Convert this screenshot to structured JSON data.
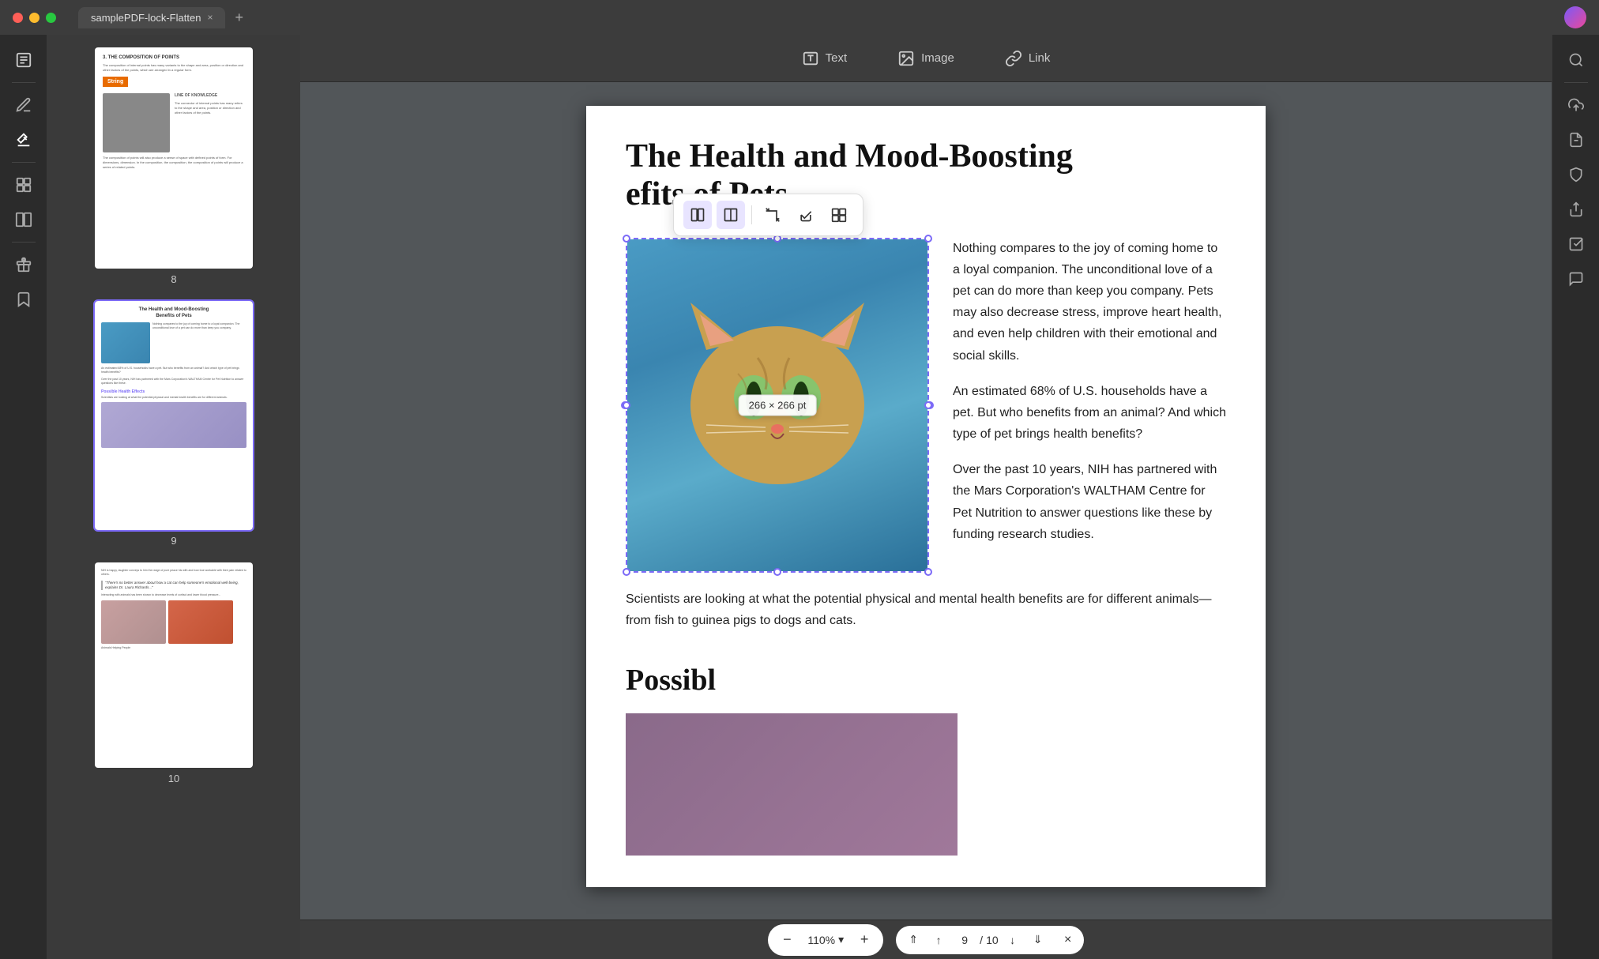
{
  "titlebar": {
    "tab_title": "samplePDF-lock-Flatten",
    "close_icon": "×",
    "add_icon": "+"
  },
  "toolbar": {
    "text_label": "Text",
    "image_label": "Image",
    "link_label": "Link"
  },
  "page9": {
    "title_line1": "The Health and Mood-Boosting",
    "title_line2": "efits of Pets",
    "paragraph1": "Nothing compares to the joy of coming home to a loyal companion. The unconditional love of a pet can do more than keep you company. Pets may also decrease stress, improve heart health,  and  even  help children  with  their emotional and social skills.",
    "paragraph2": "An estimated 68% of U.S. households have a pet. But who benefits from an animal? And which type of pet brings health benefits?",
    "paragraph3": "Over  the  past  10  years,  NIH  has partnered with the Mars Corporation's WALTHAM Centre for  Pet  Nutrition  to answer  questions  like these by funding research studies.",
    "body_text": "Scientists are looking at what the potential physical and mental health benefits are for different animals—from fish to guinea pigs to dogs and cats.",
    "section_heading": "Possibl",
    "image_dimensions": "266 × 266 pt"
  },
  "bottom_bar": {
    "zoom_decrease": "−",
    "zoom_value": "110%",
    "zoom_chevron": "▾",
    "zoom_increase": "+",
    "page_current": "9",
    "page_separator": "/",
    "page_total": "10",
    "first_page": "⇑",
    "prev_page": "↑",
    "next_page": "↓",
    "last_page": "⇓",
    "close": "×"
  },
  "sidebar_left": {
    "icons": [
      {
        "name": "notes-icon",
        "symbol": "📋"
      },
      {
        "name": "edit-icon",
        "symbol": "✏"
      },
      {
        "name": "annotate-icon",
        "symbol": "📝"
      },
      {
        "name": "pages-icon",
        "symbol": "📄"
      },
      {
        "name": "compare-icon",
        "symbol": "⊞"
      },
      {
        "name": "gift-icon",
        "symbol": "🎁"
      },
      {
        "name": "bookmark-icon",
        "symbol": "🔖"
      }
    ]
  },
  "sidebar_right": {
    "icons": [
      {
        "name": "search-icon",
        "symbol": "🔍"
      },
      {
        "name": "upload-icon",
        "symbol": "↑"
      },
      {
        "name": "pdf-icon",
        "symbol": "📄"
      },
      {
        "name": "protect-icon",
        "symbol": "🛡"
      },
      {
        "name": "share-icon",
        "symbol": "↗"
      },
      {
        "name": "check-icon",
        "symbol": "☑"
      },
      {
        "name": "comment-icon",
        "symbol": "💬"
      }
    ]
  },
  "thumbnails": {
    "page8_num": "8",
    "page9_num": "9",
    "page10_num": "10"
  },
  "img_toolbar": {
    "btn1": "⬛",
    "btn2": "▪",
    "btn3": "⬚",
    "btn4": "→",
    "btn5": "⤢"
  }
}
